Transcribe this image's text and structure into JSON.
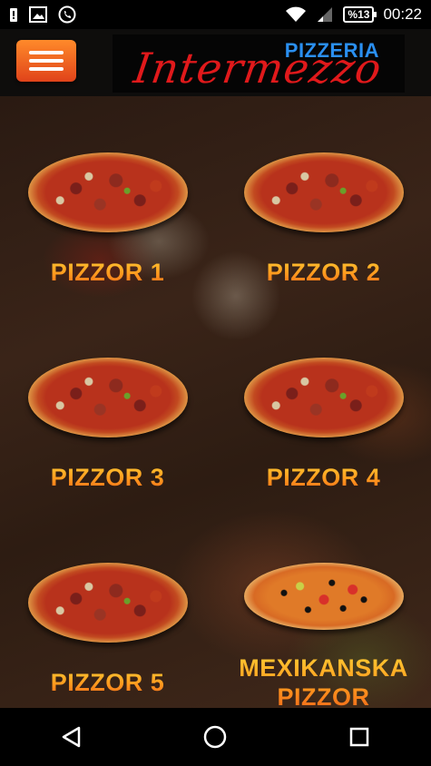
{
  "status_bar": {
    "battery": "%13",
    "time": "00:22",
    "icons": [
      "sim-alert-icon",
      "gallery-icon",
      "phone-icon",
      "wifi-icon",
      "signal-icon",
      "battery-icon"
    ]
  },
  "header": {
    "menu_icon": "hamburger-menu-icon",
    "logo_top": "PIZZERIA",
    "logo_script": "Intermezzo",
    "colors": {
      "menu_button": "#f05a1e",
      "logo_blue": "#2a8ff0",
      "logo_red": "#e0191b"
    }
  },
  "menu": {
    "items": [
      {
        "label": "PIZZOR 1",
        "icon": "pizza-image"
      },
      {
        "label": "PIZZOR 2",
        "icon": "pizza-image"
      },
      {
        "label": "PIZZOR 3",
        "icon": "pizza-image"
      },
      {
        "label": "PIZZOR 4",
        "icon": "pizza-image"
      },
      {
        "label": "PIZZOR 5",
        "icon": "pizza-image"
      },
      {
        "label": "MEXIKANSKA PIZZOR",
        "icon": "pizza-image"
      }
    ],
    "label_color": "#ff9a1e"
  },
  "nav_bar": {
    "icons": [
      "back-icon",
      "home-icon",
      "recents-icon"
    ]
  }
}
